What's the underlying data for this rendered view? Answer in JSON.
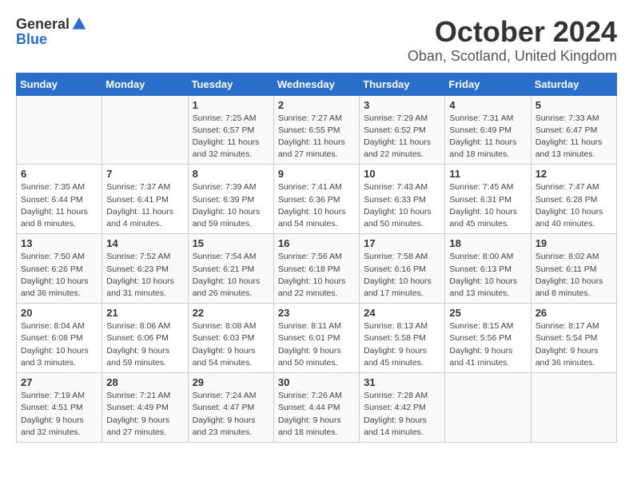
{
  "header": {
    "logo_general": "General",
    "logo_blue": "Blue",
    "month_title": "October 2024",
    "location": "Oban, Scotland, United Kingdom"
  },
  "weekdays": [
    "Sunday",
    "Monday",
    "Tuesday",
    "Wednesday",
    "Thursday",
    "Friday",
    "Saturday"
  ],
  "weeks": [
    [
      {
        "day": "",
        "sunrise": "",
        "sunset": "",
        "daylight": ""
      },
      {
        "day": "",
        "sunrise": "",
        "sunset": "",
        "daylight": ""
      },
      {
        "day": "1",
        "sunrise": "Sunrise: 7:25 AM",
        "sunset": "Sunset: 6:57 PM",
        "daylight": "Daylight: 11 hours and 32 minutes."
      },
      {
        "day": "2",
        "sunrise": "Sunrise: 7:27 AM",
        "sunset": "Sunset: 6:55 PM",
        "daylight": "Daylight: 11 hours and 27 minutes."
      },
      {
        "day": "3",
        "sunrise": "Sunrise: 7:29 AM",
        "sunset": "Sunset: 6:52 PM",
        "daylight": "Daylight: 11 hours and 22 minutes."
      },
      {
        "day": "4",
        "sunrise": "Sunrise: 7:31 AM",
        "sunset": "Sunset: 6:49 PM",
        "daylight": "Daylight: 11 hours and 18 minutes."
      },
      {
        "day": "5",
        "sunrise": "Sunrise: 7:33 AM",
        "sunset": "Sunset: 6:47 PM",
        "daylight": "Daylight: 11 hours and 13 minutes."
      }
    ],
    [
      {
        "day": "6",
        "sunrise": "Sunrise: 7:35 AM",
        "sunset": "Sunset: 6:44 PM",
        "daylight": "Daylight: 11 hours and 8 minutes."
      },
      {
        "day": "7",
        "sunrise": "Sunrise: 7:37 AM",
        "sunset": "Sunset: 6:41 PM",
        "daylight": "Daylight: 11 hours and 4 minutes."
      },
      {
        "day": "8",
        "sunrise": "Sunrise: 7:39 AM",
        "sunset": "Sunset: 6:39 PM",
        "daylight": "Daylight: 10 hours and 59 minutes."
      },
      {
        "day": "9",
        "sunrise": "Sunrise: 7:41 AM",
        "sunset": "Sunset: 6:36 PM",
        "daylight": "Daylight: 10 hours and 54 minutes."
      },
      {
        "day": "10",
        "sunrise": "Sunrise: 7:43 AM",
        "sunset": "Sunset: 6:33 PM",
        "daylight": "Daylight: 10 hours and 50 minutes."
      },
      {
        "day": "11",
        "sunrise": "Sunrise: 7:45 AM",
        "sunset": "Sunset: 6:31 PM",
        "daylight": "Daylight: 10 hours and 45 minutes."
      },
      {
        "day": "12",
        "sunrise": "Sunrise: 7:47 AM",
        "sunset": "Sunset: 6:28 PM",
        "daylight": "Daylight: 10 hours and 40 minutes."
      }
    ],
    [
      {
        "day": "13",
        "sunrise": "Sunrise: 7:50 AM",
        "sunset": "Sunset: 6:26 PM",
        "daylight": "Daylight: 10 hours and 36 minutes."
      },
      {
        "day": "14",
        "sunrise": "Sunrise: 7:52 AM",
        "sunset": "Sunset: 6:23 PM",
        "daylight": "Daylight: 10 hours and 31 minutes."
      },
      {
        "day": "15",
        "sunrise": "Sunrise: 7:54 AM",
        "sunset": "Sunset: 6:21 PM",
        "daylight": "Daylight: 10 hours and 26 minutes."
      },
      {
        "day": "16",
        "sunrise": "Sunrise: 7:56 AM",
        "sunset": "Sunset: 6:18 PM",
        "daylight": "Daylight: 10 hours and 22 minutes."
      },
      {
        "day": "17",
        "sunrise": "Sunrise: 7:58 AM",
        "sunset": "Sunset: 6:16 PM",
        "daylight": "Daylight: 10 hours and 17 minutes."
      },
      {
        "day": "18",
        "sunrise": "Sunrise: 8:00 AM",
        "sunset": "Sunset: 6:13 PM",
        "daylight": "Daylight: 10 hours and 13 minutes."
      },
      {
        "day": "19",
        "sunrise": "Sunrise: 8:02 AM",
        "sunset": "Sunset: 6:11 PM",
        "daylight": "Daylight: 10 hours and 8 minutes."
      }
    ],
    [
      {
        "day": "20",
        "sunrise": "Sunrise: 8:04 AM",
        "sunset": "Sunset: 6:08 PM",
        "daylight": "Daylight: 10 hours and 3 minutes."
      },
      {
        "day": "21",
        "sunrise": "Sunrise: 8:06 AM",
        "sunset": "Sunset: 6:06 PM",
        "daylight": "Daylight: 9 hours and 59 minutes."
      },
      {
        "day": "22",
        "sunrise": "Sunrise: 8:08 AM",
        "sunset": "Sunset: 6:03 PM",
        "daylight": "Daylight: 9 hours and 54 minutes."
      },
      {
        "day": "23",
        "sunrise": "Sunrise: 8:11 AM",
        "sunset": "Sunset: 6:01 PM",
        "daylight": "Daylight: 9 hours and 50 minutes."
      },
      {
        "day": "24",
        "sunrise": "Sunrise: 8:13 AM",
        "sunset": "Sunset: 5:58 PM",
        "daylight": "Daylight: 9 hours and 45 minutes."
      },
      {
        "day": "25",
        "sunrise": "Sunrise: 8:15 AM",
        "sunset": "Sunset: 5:56 PM",
        "daylight": "Daylight: 9 hours and 41 minutes."
      },
      {
        "day": "26",
        "sunrise": "Sunrise: 8:17 AM",
        "sunset": "Sunset: 5:54 PM",
        "daylight": "Daylight: 9 hours and 36 minutes."
      }
    ],
    [
      {
        "day": "27",
        "sunrise": "Sunrise: 7:19 AM",
        "sunset": "Sunset: 4:51 PM",
        "daylight": "Daylight: 9 hours and 32 minutes."
      },
      {
        "day": "28",
        "sunrise": "Sunrise: 7:21 AM",
        "sunset": "Sunset: 4:49 PM",
        "daylight": "Daylight: 9 hours and 27 minutes."
      },
      {
        "day": "29",
        "sunrise": "Sunrise: 7:24 AM",
        "sunset": "Sunset: 4:47 PM",
        "daylight": "Daylight: 9 hours and 23 minutes."
      },
      {
        "day": "30",
        "sunrise": "Sunrise: 7:26 AM",
        "sunset": "Sunset: 4:44 PM",
        "daylight": "Daylight: 9 hours and 18 minutes."
      },
      {
        "day": "31",
        "sunrise": "Sunrise: 7:28 AM",
        "sunset": "Sunset: 4:42 PM",
        "daylight": "Daylight: 9 hours and 14 minutes."
      },
      {
        "day": "",
        "sunrise": "",
        "sunset": "",
        "daylight": ""
      },
      {
        "day": "",
        "sunrise": "",
        "sunset": "",
        "daylight": ""
      }
    ]
  ]
}
